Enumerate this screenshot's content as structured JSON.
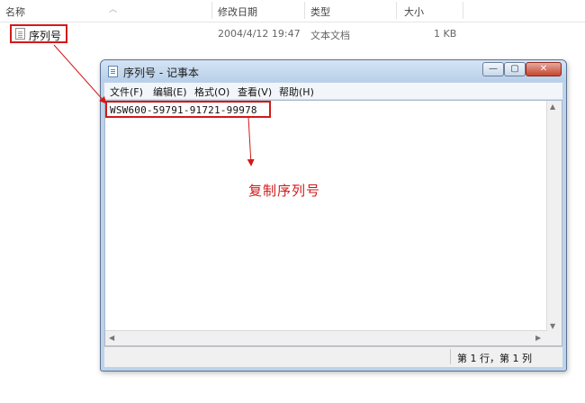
{
  "explorer": {
    "columns": {
      "name": "名称",
      "date_modified": "修改日期",
      "type": "类型",
      "size": "大小"
    },
    "file": {
      "name": "序列号",
      "date_modified": "2004/4/12 19:47",
      "type": "文本文档",
      "size": "1 KB"
    }
  },
  "notepad": {
    "title": "序列号 - 记事本",
    "buttons": {
      "minimize": "—",
      "maximize": "▢",
      "close": "✕"
    },
    "menu": [
      "文件(F)",
      "编辑(E)",
      "格式(O)",
      "查看(V)",
      "帮助(H)"
    ],
    "content": "WSW600-59791-91721-99978",
    "status": "第 1 行，第 1 列"
  },
  "annotation": {
    "label": "复制序列号",
    "color": "#d11a1a"
  }
}
